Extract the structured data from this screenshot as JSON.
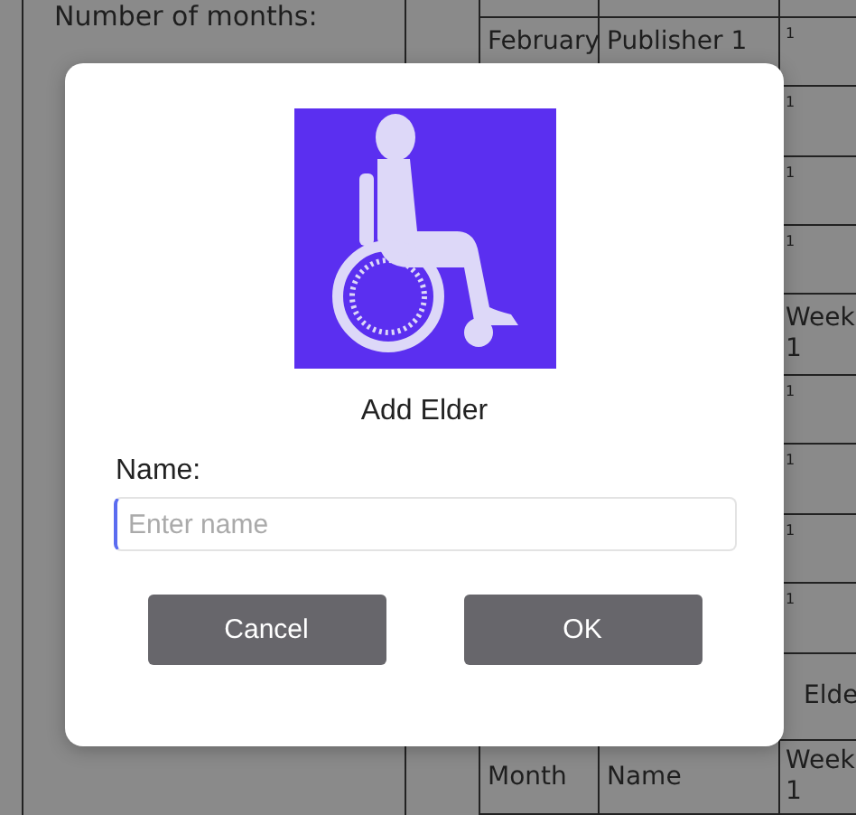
{
  "background": {
    "labels": [
      "Number of months:"
    ],
    "rows": [
      {},
      {
        "month": "February",
        "name": "Publisher 1",
        "week": "1",
        "small": true
      },
      {
        "week": "1",
        "small": true
      },
      {
        "week": "1",
        "small": true
      },
      {
        "week": "1",
        "small": true
      },
      {
        "week": "Week 1",
        "small": false
      },
      {
        "week": "1",
        "small": true
      },
      {
        "week": "1",
        "small": true
      },
      {
        "week": "1",
        "small": true
      },
      {
        "week": "1",
        "small": true
      },
      {
        "week": "Elde",
        "small": false
      },
      {
        "month": "Month",
        "name": "Name",
        "week": "Week 1",
        "small": false
      }
    ]
  },
  "dialog": {
    "title": "Add Elder",
    "field_label": "Name:",
    "field": {
      "placeholder": "Enter name"
    },
    "buttons": [
      "Cancel",
      "OK"
    ]
  }
}
